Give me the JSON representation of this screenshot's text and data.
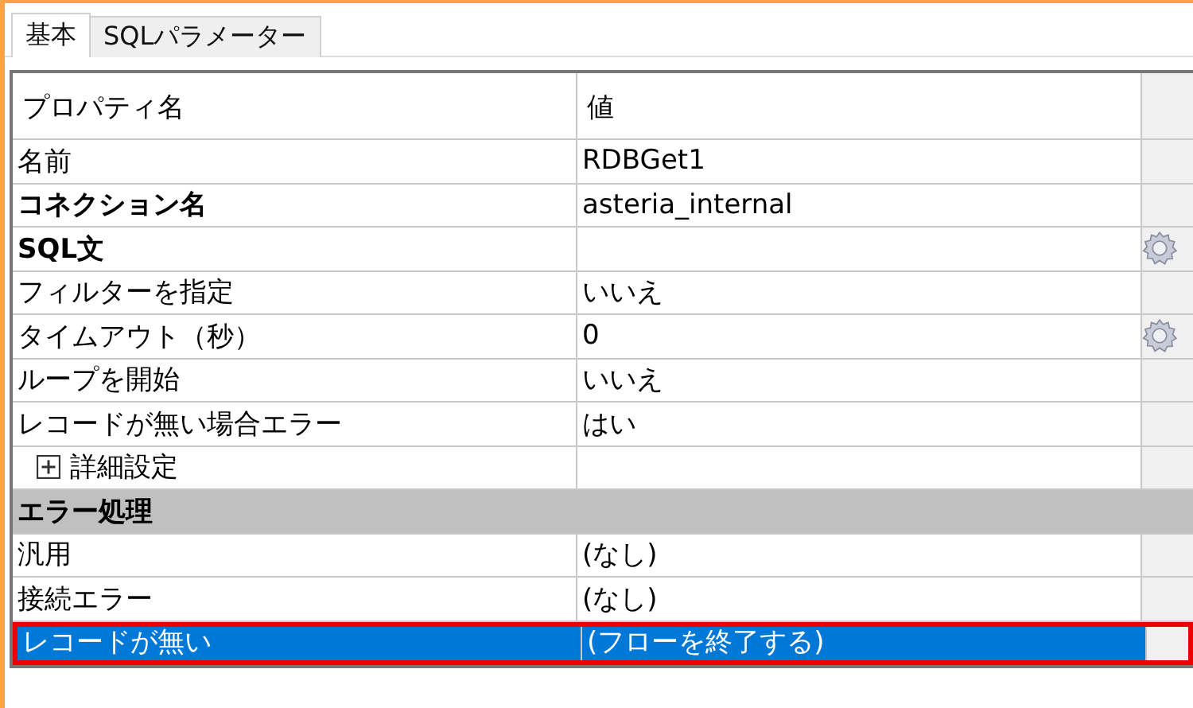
{
  "tabs": [
    {
      "label": "基本",
      "selected": true
    },
    {
      "label": "SQLパラメーター",
      "selected": false
    }
  ],
  "table": {
    "columns": [
      "プロパティ名",
      "値"
    ],
    "rows": [
      {
        "kind": "property",
        "name": "名前",
        "value": "RDBGet1",
        "bold": false,
        "has_button": false,
        "selected": false
      },
      {
        "kind": "property",
        "name": "コネクション名",
        "value": "asteria_internal",
        "bold": true,
        "has_button": false,
        "selected": false
      },
      {
        "kind": "property",
        "name": "SQL文",
        "bold": true,
        "has_button": true,
        "selected": false
      },
      {
        "kind": "property",
        "name": "フィルターを指定",
        "value": "いいえ",
        "bold": false,
        "has_button": false,
        "selected": false
      },
      {
        "kind": "property",
        "name": "タイムアウト（秒）",
        "value": "0",
        "bold": false,
        "has_button": true,
        "selected": false
      },
      {
        "kind": "property",
        "name": "ループを開始",
        "value": "いいえ",
        "bold": false,
        "has_button": false,
        "selected": false
      },
      {
        "kind": "property",
        "name": "レコードが無い場合エラー",
        "value": "はい",
        "bold": false,
        "has_button": false,
        "selected": false
      },
      {
        "kind": "group",
        "name": "詳細設定",
        "expanded": false,
        "selected": false
      },
      {
        "kind": "section",
        "name": "エラー処理",
        "selected": false
      },
      {
        "kind": "property",
        "name": "汎用",
        "value": "(なし)",
        "bold": false,
        "has_button": false,
        "selected": false
      },
      {
        "kind": "property",
        "name": "接続エラー",
        "value": "(なし)",
        "bold": false,
        "has_button": false,
        "selected": false
      },
      {
        "kind": "property",
        "name": "レコードが無い",
        "value": "(フローを終了する)",
        "bold": false,
        "has_button": false,
        "selected": true
      }
    ]
  }
}
